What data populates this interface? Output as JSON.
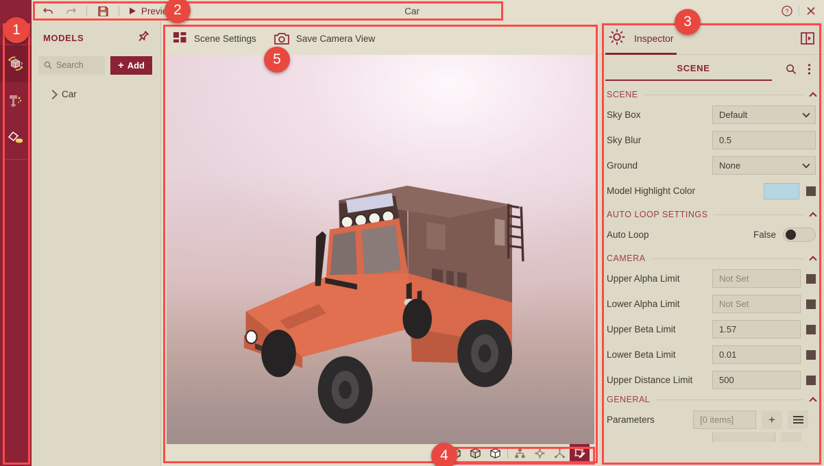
{
  "window": {
    "title": "Car",
    "help_icon": "help-circle-icon",
    "close_icon": "close-icon"
  },
  "toolbar": {
    "undo_icon": "undo-icon",
    "redo_icon": "redo-icon",
    "save_icon": "save-disk-icon",
    "play_icon": "play-icon",
    "preview_label": "Preview"
  },
  "rail": {
    "items": [
      {
        "icon": "rotate-cube-icon",
        "name": "models-rail-item",
        "active": true
      },
      {
        "icon": "paint-drip-icon",
        "name": "materials-rail-item",
        "active": false
      },
      {
        "icon": "diamond-coins-icon",
        "name": "assets-rail-item",
        "active": false
      }
    ]
  },
  "models_panel": {
    "title": "MODELS",
    "pin_icon": "pin-icon",
    "search_icon": "search-icon",
    "search_placeholder": "Search",
    "add_label": "Add",
    "add_icon": "plus-icon",
    "tree": [
      {
        "label": "Car",
        "expand_icon": "chevron-right-icon"
      }
    ]
  },
  "viewport": {
    "scene_settings_label": "Scene Settings",
    "scene_settings_icon": "dashboard-grid-icon",
    "save_camera_label": "Save Camera View",
    "save_camera_icon": "camera-icon",
    "bottom_tools": [
      {
        "icon": "wireframe-cube-icon",
        "name": "wireframe-view-button",
        "selected": false
      },
      {
        "icon": "shaded-wireframe-cube-icon",
        "name": "shaded-wireframe-view-button",
        "selected": false
      },
      {
        "icon": "solid-cube-icon",
        "name": "solid-view-button",
        "selected": false
      },
      {
        "icon": "hierarchy-node-icon",
        "name": "hierarchy-button",
        "selected": false
      },
      {
        "icon": "move-gizmo-icon",
        "name": "move-gizmo-button",
        "selected": false
      },
      {
        "icon": "axis-gizmo-icon",
        "name": "axis-gizmo-button",
        "selected": false
      },
      {
        "icon": "polygon-edit-icon",
        "name": "polygon-edit-button",
        "selected": true
      }
    ],
    "model_name": "Car"
  },
  "inspector": {
    "gear_icon": "gear-icon",
    "title": "Inspector",
    "collapse_icon": "panel-collapse-icon",
    "tab_label": "SCENE",
    "search_icon": "search-icon",
    "menu_icon": "kebab-menu-icon",
    "sections": [
      {
        "label": "SCENE",
        "collapse_icon": "chevron-up-icon",
        "rows": [
          {
            "label": "Sky Box",
            "type": "select",
            "value": "Default"
          },
          {
            "label": "Sky Blur",
            "type": "text",
            "value": "0.5"
          },
          {
            "label": "Ground",
            "type": "select",
            "value": "None"
          },
          {
            "label": "Model Highlight Color",
            "type": "color",
            "value": "#b7d6e2",
            "swatch": "#5b4a44"
          }
        ]
      },
      {
        "label": "AUTO LOOP SETTINGS",
        "collapse_icon": "chevron-up-icon",
        "rows": [
          {
            "label": "Auto Loop",
            "type": "toggle",
            "value": "False"
          }
        ]
      },
      {
        "label": "CAMERA",
        "collapse_icon": "chevron-up-icon",
        "rows": [
          {
            "label": "Upper Alpha Limit",
            "type": "text",
            "value": "",
            "placeholder": "Not Set",
            "swatch": "#5b4a44"
          },
          {
            "label": "Lower Alpha Limit",
            "type": "text",
            "value": "",
            "placeholder": "Not Set",
            "swatch": "#5b4a44"
          },
          {
            "label": "Upper Beta Limit",
            "type": "text",
            "value": "1.57",
            "swatch": "#5b4a44"
          },
          {
            "label": "Lower Beta Limit",
            "type": "text",
            "value": "0.01",
            "swatch": "#5b4a44"
          },
          {
            "label": "Upper Distance Limit",
            "type": "text",
            "value": "500",
            "swatch": "#5b4a44"
          }
        ]
      },
      {
        "label": "GENERAL",
        "collapse_icon": "chevron-up-icon",
        "rows": [
          {
            "label": "Parameters",
            "type": "items",
            "placeholder": "[0 items]",
            "add_icon": "plus-icon",
            "list_icon": "list-lines-icon"
          }
        ]
      }
    ]
  },
  "annotations": [
    {
      "number": "1",
      "target": "left-icon-rail"
    },
    {
      "number": "2",
      "target": "top-toolbar"
    },
    {
      "number": "3",
      "target": "inspector-panel"
    },
    {
      "number": "4",
      "target": "viewport-bottom-toolbar"
    },
    {
      "number": "5",
      "target": "viewport-area"
    }
  ],
  "colors": {
    "brand": "#8c2236",
    "panel_bg": "#ddd9c6",
    "app_bg": "#e3dfcc",
    "annotation": "#fc4a4a",
    "badge": "#e8483f"
  }
}
